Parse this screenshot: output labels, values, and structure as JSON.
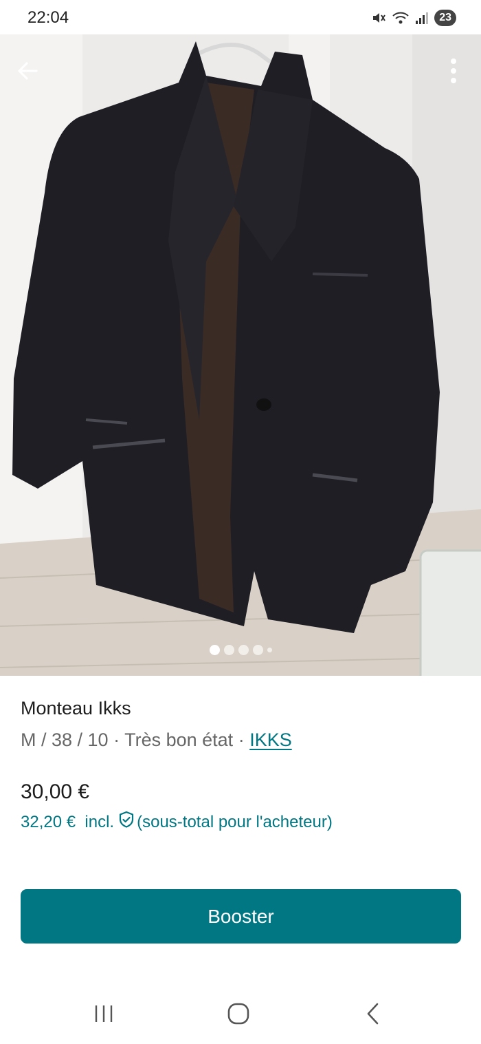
{
  "status_bar": {
    "time": "22:04",
    "battery": "23",
    "icons": [
      "mute-icon",
      "wifi-icon",
      "signal-icon"
    ]
  },
  "gallery": {
    "image_count": 5,
    "active_index": 0,
    "top_left_icon": "back-arrow-icon",
    "top_right_icon": "more-vertical-icon"
  },
  "item": {
    "title": "Monteau Ikks",
    "size": "M / 38 / 10",
    "separator": " · ",
    "condition": "Très bon état",
    "brand": "IKKS",
    "price": "30,00 €",
    "price_incl_amount": "32,20 €",
    "price_incl_label": "incl.",
    "price_incl_note": "(sous-total pour l'acheteur)"
  },
  "actions": {
    "booster_label": "Booster"
  },
  "colors": {
    "accent": "#007782",
    "text": "#1c1c1c",
    "muted": "#666666"
  }
}
